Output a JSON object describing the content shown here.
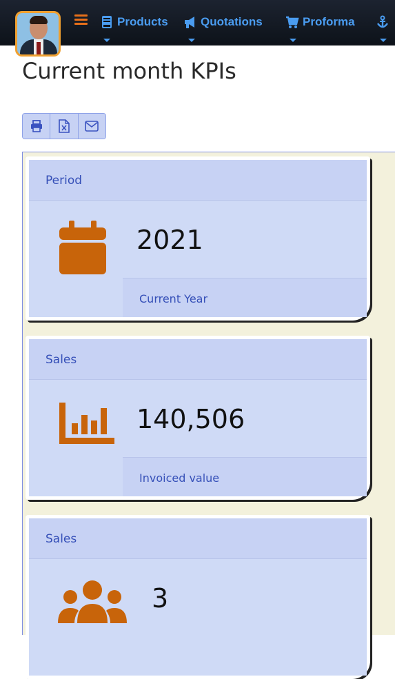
{
  "nav": {
    "items": [
      {
        "label": "Products",
        "icon": "book-icon"
      },
      {
        "label": "Quotations",
        "icon": "megaphone-icon"
      },
      {
        "label": "Proforma",
        "icon": "cart-icon"
      }
    ],
    "last_icon": "anchor-icon",
    "menu_icon": "hamburger-icon",
    "accent_color": "#4a9cf0",
    "menu_color": "#e8701a"
  },
  "page": {
    "title": "Current month KPIs"
  },
  "toolbar": {
    "buttons": [
      "print-icon",
      "excel-icon",
      "email-icon"
    ]
  },
  "kpis": [
    {
      "label": "Period",
      "value": "2021",
      "note": "Current Year",
      "icon": "calendar-icon"
    },
    {
      "label": "Sales",
      "value": "140,506",
      "note": "Invoiced value",
      "icon": "bar-chart-icon"
    },
    {
      "label": "Sales",
      "value": "3",
      "note": "",
      "icon": "users-icon"
    }
  ],
  "colors": {
    "icon": "#c8640a",
    "card_bg": "#cfdaf6",
    "label": "#3650b8",
    "panel_bg": "#f3f1dc"
  }
}
